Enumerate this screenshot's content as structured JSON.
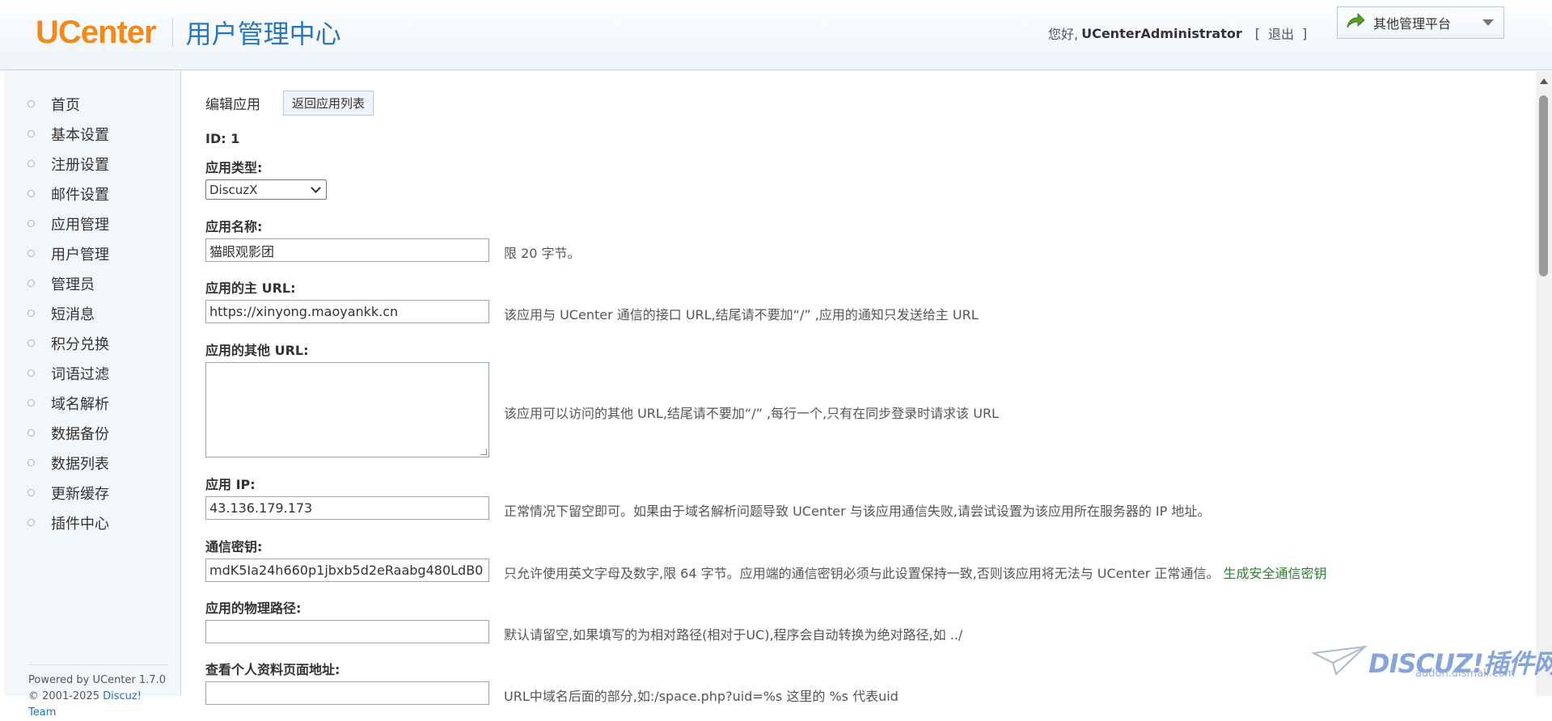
{
  "header": {
    "logo_text": "UCenter",
    "subtitle": "用户管理中心",
    "greeting": "您好,",
    "username": "UCenterAdministrator",
    "logout_open": "[",
    "logout": "退出",
    "logout_close": "]",
    "platform_label": "其他管理平台"
  },
  "sidebar": {
    "items": [
      {
        "label": "首页"
      },
      {
        "label": "基本设置"
      },
      {
        "label": "注册设置"
      },
      {
        "label": "邮件设置"
      },
      {
        "label": "应用管理"
      },
      {
        "label": "用户管理"
      },
      {
        "label": "管理员"
      },
      {
        "label": "短消息"
      },
      {
        "label": "积分兑换"
      },
      {
        "label": "词语过滤"
      },
      {
        "label": "域名解析"
      },
      {
        "label": "数据备份"
      },
      {
        "label": "数据列表"
      },
      {
        "label": "更新缓存"
      },
      {
        "label": "插件中心"
      }
    ],
    "footer_powered": "Powered by UCenter 1.7.0",
    "footer_copyright": "© 2001-2025",
    "footer_team": "Discuz! Team"
  },
  "main": {
    "title": "编辑应用",
    "back_button": "返回应用列表",
    "id_line": "ID: 1",
    "app_type": {
      "label": "应用类型:",
      "value": "DiscuzX"
    },
    "app_name": {
      "label": "应用名称:",
      "value": "猫眼观影团",
      "hint": "限 20 字节。"
    },
    "main_url": {
      "label": "应用的主 URL:",
      "value": "https://xinyong.maoyankk.cn",
      "hint": "该应用与 UCenter 通信的接口 URL,结尾请不要加“/” ,应用的通知只发送给主 URL"
    },
    "other_url": {
      "label": "应用的其他 URL:",
      "value": "",
      "hint": "该应用可以访问的其他 URL,结尾请不要加“/” ,每行一个,只有在同步登录时请求该 URL"
    },
    "app_ip": {
      "label": "应用 IP:",
      "value": "43.136.179.173",
      "hint": "正常情况下留空即可。如果由于域名解析问题导致 UCenter 与该应用通信失败,请尝试设置为该应用所在服务器的 IP 地址。"
    },
    "comm_key": {
      "label": "通信密钥:",
      "value": "mdK5Ia24h660p1jbxb5d2eRaabg480LdB0",
      "hint": "只允许使用英文字母及数字,限 64 字节。应用端的通信密钥必须与此设置保持一致,否则该应用将无法与 UCenter 正常通信。",
      "link": "生成安全通信密钥"
    },
    "phys_path": {
      "label": "应用的物理路径:",
      "value": "",
      "hint": "默认请留空,如果填写的为相对路径(相对于UC),程序会自动转换为绝对路径,如 ../"
    },
    "profile_url": {
      "label": "查看个人资料页面地址:",
      "value": "",
      "hint": "URL中域名后面的部分,如:/space.php?uid=%s 这里的 %s 代表uid"
    }
  },
  "watermark": {
    "main": "DISCUZ!插件网",
    "sub": "addon.dismall.com"
  },
  "colors": {
    "brand_orange": "#f08a1a",
    "brand_blue": "#2a78b8",
    "link_green": "#2e7d32"
  }
}
